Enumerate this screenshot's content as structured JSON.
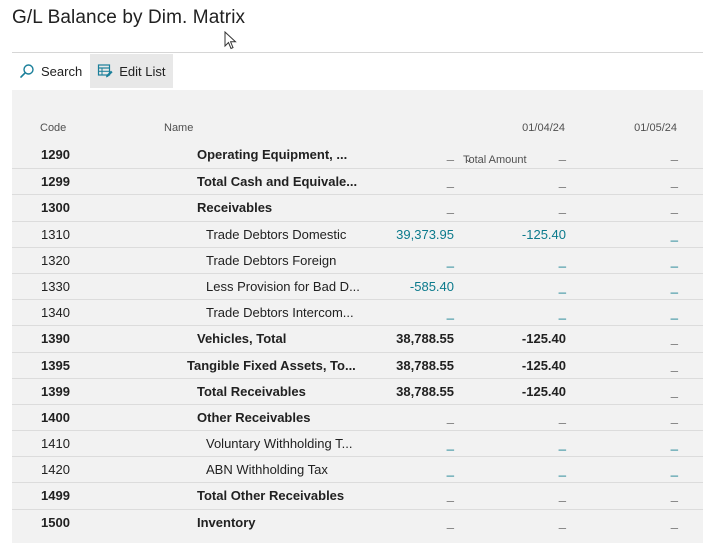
{
  "page": {
    "title": "G/L Balance by Dim. Matrix"
  },
  "toolbar": {
    "search_label": "Search",
    "edit_list_label": "Edit List"
  },
  "columns": {
    "code": "Code",
    "name": "Name",
    "total": "Total Amount",
    "col1": "01/04/24",
    "col2": "01/05/24"
  },
  "rows": [
    {
      "code": "1290",
      "name": "Operating Equipment, ...",
      "total": "_",
      "c1": "_",
      "c2": "_",
      "bold": true,
      "indent": 1,
      "link": false
    },
    {
      "code": "1299",
      "name": "Total Cash and Equivale...",
      "total": "_",
      "c1": "_",
      "c2": "_",
      "bold": true,
      "indent": 1,
      "link": false
    },
    {
      "code": "1300",
      "name": "Receivables",
      "total": "_",
      "c1": "_",
      "c2": "_",
      "bold": true,
      "indent": 1,
      "link": false
    },
    {
      "code": "1310",
      "name": "Trade Debtors Domestic",
      "total": "39,373.95",
      "c1": "-125.40",
      "c2": "_",
      "bold": false,
      "indent": 2,
      "link": true
    },
    {
      "code": "1320",
      "name": "Trade Debtors Foreign",
      "total": "_",
      "c1": "_",
      "c2": "_",
      "bold": false,
      "indent": 2,
      "link": true
    },
    {
      "code": "1330",
      "name": "Less Provision for Bad D...",
      "total": "-585.40",
      "c1": "_",
      "c2": "_",
      "bold": false,
      "indent": 2,
      "link": true
    },
    {
      "code": "1340",
      "name": "Trade Debtors Intercom...",
      "total": "_",
      "c1": "_",
      "c2": "_",
      "bold": false,
      "indent": 2,
      "link": true
    },
    {
      "code": "1390",
      "name": "Vehicles, Total",
      "total": "38,788.55",
      "c1": "-125.40",
      "c2": "_",
      "bold": true,
      "indent": 1,
      "link": false
    },
    {
      "code": "1395",
      "name": "Tangible Fixed Assets, To...",
      "total": "38,788.55",
      "c1": "-125.40",
      "c2": "_",
      "bold": true,
      "indent": 0,
      "link": false
    },
    {
      "code": "1399",
      "name": "Total Receivables",
      "total": "38,788.55",
      "c1": "-125.40",
      "c2": "_",
      "bold": true,
      "indent": 1,
      "link": false
    },
    {
      "code": "1400",
      "name": "Other Receivables",
      "total": "_",
      "c1": "_",
      "c2": "_",
      "bold": true,
      "indent": 1,
      "link": false
    },
    {
      "code": "1410",
      "name": "Voluntary Withholding T...",
      "total": "_",
      "c1": "_",
      "c2": "_",
      "bold": false,
      "indent": 2,
      "link": true
    },
    {
      "code": "1420",
      "name": "ABN Withholding Tax",
      "total": "_",
      "c1": "_",
      "c2": "_",
      "bold": false,
      "indent": 2,
      "link": true
    },
    {
      "code": "1499",
      "name": "Total Other Receivables",
      "total": "_",
      "c1": "_",
      "c2": "_",
      "bold": true,
      "indent": 1,
      "link": false
    },
    {
      "code": "1500",
      "name": "Inventory",
      "total": "_",
      "c1": "_",
      "c2": "_",
      "bold": true,
      "indent": 1,
      "link": false
    }
  ]
}
